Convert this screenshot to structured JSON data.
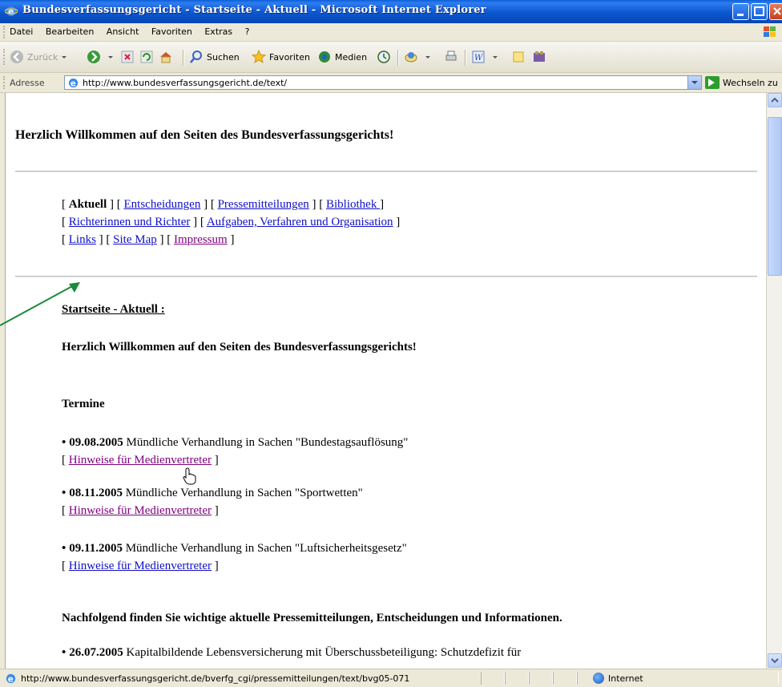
{
  "window": {
    "title": "Bundesverfassungsgericht - Startseite - Aktuell - Microsoft Internet Explorer"
  },
  "menu": [
    "Datei",
    "Bearbeiten",
    "Ansicht",
    "Favoriten",
    "Extras",
    "?"
  ],
  "toolbar": {
    "back": "Zurück",
    "search": "Suchen",
    "favorites": "Favoriten",
    "media": "Medien"
  },
  "address": {
    "label": "Adresse",
    "url": "http://www.bundesverfassungsgericht.de/text/",
    "go": "Wechseln zu"
  },
  "page": {
    "heading": "Herzlich Willkommen auf den Seiten des Bundesverfassungsgerichts!",
    "nav": {
      "aktuell": "Aktuell",
      "entscheidungen": "Entscheidungen",
      "pressemitteilungen": "Pressemitteilungen",
      "bibliothek": "Bibliothek ",
      "richter": "Richterinnen und Richter",
      "aufgaben": "Aufgaben, Verfahren und Organisation",
      "links": "Links",
      "sitemap": "Site Map",
      "impressum": "Impressum"
    },
    "breadcrumb": "Startseite - Aktuell :",
    "welcome": "Herzlich Willkommen auf den Seiten des Bundesverfassungsgerichts!",
    "termine_heading": "Termine",
    "termine": [
      {
        "date": "09.08.2005",
        "text": " Mündliche Verhandlung in Sachen \"Bundestagsauflösung\"",
        "link": "Hinweise für Medienvertreter"
      },
      {
        "date": "08.11.2005",
        "text": " Mündliche Verhandlung in Sachen \"Sportwetten\"",
        "link": "Hinweise für Medienvertreter"
      },
      {
        "date": "09.11.2005",
        "text": " Mündliche Verhandlung in Sachen \"Luftsicherheitsgesetz\"",
        "link": "Hinweise für Medienvertreter"
      }
    ],
    "press_heading": "Nachfolgend finden Sie wichtige aktuelle Pressemitteilungen, Entscheidungen und Informationen.",
    "press_item": {
      "date": "26.07.2005",
      "text": " Kapitalbildende Lebensversicherung mit Überschussbeteiligung: Schutzdefizit für"
    }
  },
  "status": {
    "url": "http://www.bundesverfassungsgericht.de/bverfg_cgi/pressemitteilungen/text/bvg05-071",
    "zone": "Internet"
  },
  "colors": {
    "link": "#1010c8",
    "visited": "#800080",
    "annotation_arrow": "#1a8a3a"
  }
}
